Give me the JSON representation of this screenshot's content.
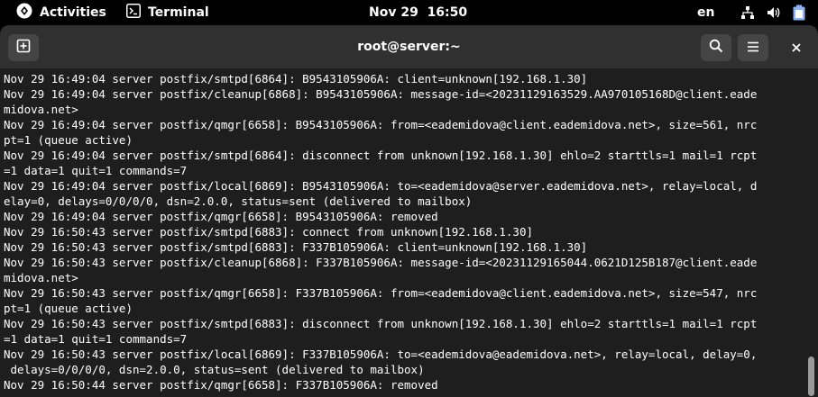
{
  "topbar": {
    "activities_label": "Activities",
    "app_label": "Terminal",
    "clock": "Nov 29  16:50",
    "language": "en",
    "icons": [
      "fedora-logo-icon",
      "terminal-app-icon",
      "network-icon",
      "volume-icon",
      "battery-icon"
    ]
  },
  "window": {
    "title": "root@server:~",
    "buttons": [
      "new-tab-icon",
      "search-icon",
      "hamburger-menu-icon",
      "close-icon"
    ]
  },
  "terminal": {
    "lines": [
      "Nov 29 16:49:04 server postfix/smtpd[6864]: B9543105906A: client=unknown[192.168.1.30]",
      "Nov 29 16:49:04 server postfix/cleanup[6868]: B9543105906A: message-id=<20231129163529.AA970105168D@client.eade",
      "midova.net>",
      "Nov 29 16:49:04 server postfix/qmgr[6658]: B9543105906A: from=<eademidova@client.eademidova.net>, size=561, nrc",
      "pt=1 (queue active)",
      "Nov 29 16:49:04 server postfix/smtpd[6864]: disconnect from unknown[192.168.1.30] ehlo=2 starttls=1 mail=1 rcpt",
      "=1 data=1 quit=1 commands=7",
      "Nov 29 16:49:04 server postfix/local[6869]: B9543105906A: to=<eademidova@server.eademidova.net>, relay=local, d",
      "elay=0, delays=0/0/0/0, dsn=2.0.0, status=sent (delivered to mailbox)",
      "Nov 29 16:49:04 server postfix/qmgr[6658]: B9543105906A: removed",
      "Nov 29 16:50:43 server postfix/smtpd[6883]: connect from unknown[192.168.1.30]",
      "Nov 29 16:50:43 server postfix/smtpd[6883]: F337B105906A: client=unknown[192.168.1.30]",
      "Nov 29 16:50:43 server postfix/cleanup[6868]: F337B105906A: message-id=<20231129165044.0621D125B187@client.eade",
      "midova.net>",
      "Nov 29 16:50:43 server postfix/qmgr[6658]: F337B105906A: from=<eademidova@client.eademidova.net>, size=547, nrc",
      "pt=1 (queue active)",
      "Nov 29 16:50:43 server postfix/smtpd[6883]: disconnect from unknown[192.168.1.30] ehlo=2 starttls=1 mail=1 rcpt",
      "=1 data=1 quit=1 commands=7",
      "Nov 29 16:50:43 server postfix/local[6869]: F337B105906A: to=<eademidova@eademidova.net>, relay=local, delay=0,",
      " delays=0/0/0/0, dsn=2.0.0, status=sent (delivered to mailbox)",
      "Nov 29 16:50:44 server postfix/qmgr[6658]: F337B105906A: removed"
    ]
  },
  "colors": {
    "topbar_bg": "#000000",
    "header_bg": "#303030",
    "terminal_bg": "#1e1e1e",
    "terminal_fg": "#ffffff"
  }
}
